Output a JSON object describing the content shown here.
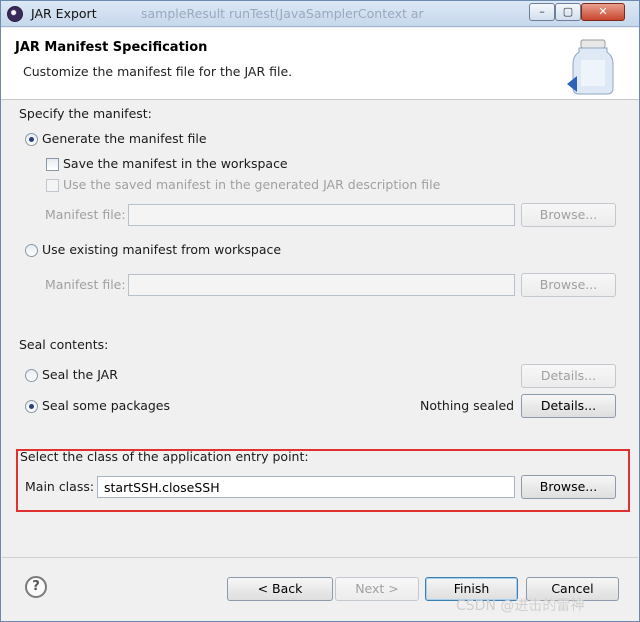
{
  "window": {
    "title": "JAR Export",
    "background_text": "sampleResult  runTest(JavaSamplerContext  ar",
    "controls": {
      "minimize": "–",
      "maximize": "▢",
      "close": "✕"
    }
  },
  "banner": {
    "title": "JAR Manifest Specification",
    "description": "Customize the manifest file for the JAR file."
  },
  "manifest": {
    "heading": "Specify the manifest:",
    "generate_label": "Generate the manifest file",
    "generate_selected": true,
    "save_label": "Save the manifest in the workspace",
    "save_checked": false,
    "use_saved_label": "Use the saved manifest in the generated JAR description file",
    "use_saved_checked": false,
    "manifest_file_label": "Manifest file:",
    "manifest_file_value": "",
    "browse_label": "Browse...",
    "use_existing_label": "Use existing manifest from workspace",
    "use_existing_selected": false,
    "manifest_file_label_2": "Manifest file:",
    "browse_label_2": "Browse..."
  },
  "seal": {
    "heading": "Seal contents:",
    "seal_jar_label": "Seal the JAR",
    "seal_jar_selected": false,
    "details_label": "Details...",
    "seal_some_label": "Seal some packages",
    "seal_some_selected": true,
    "nothing_sealed": "Nothing sealed",
    "details_label_2": "Details..."
  },
  "entry_point": {
    "heading": "Select the class of the application entry point:",
    "main_class_label": "Main class:",
    "main_class_value": "startSSH.closeSSH",
    "browse_label": "Browse..."
  },
  "footer": {
    "help": "?",
    "back": "< Back",
    "next": "Next >",
    "finish": "Finish",
    "cancel": "Cancel"
  },
  "watermark": "CSDN @进击的雷神",
  "colors": {
    "highlight": "#e03030",
    "disabled_text": "#a0a0a0",
    "default_button_border": "#3c7fb1"
  }
}
